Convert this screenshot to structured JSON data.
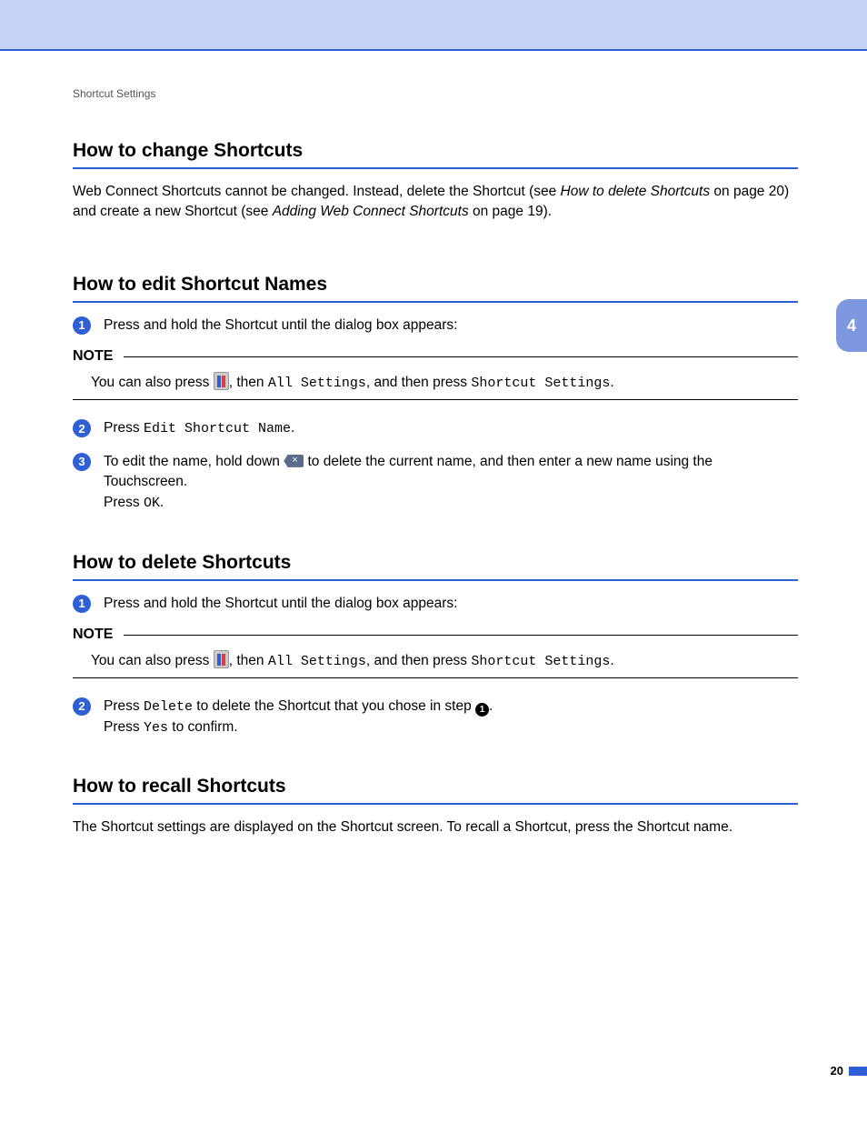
{
  "breadcrumb": "Shortcut Settings",
  "chapter_tab": "4",
  "page_number": "20",
  "sections": {
    "change": {
      "title": "How to change Shortcuts",
      "p1a": "Web Connect Shortcuts cannot be changed. Instead, delete the Shortcut (see ",
      "p1_link1": "How to delete Shortcuts",
      "p1b": " on page 20) and create a new Shortcut (see ",
      "p1_link2": "Adding Web Connect Shortcuts",
      "p1c": " on page 19)."
    },
    "edit": {
      "title": "How to edit Shortcut Names",
      "step1": "Press and hold the Shortcut until the dialog box appears:",
      "note_label": "NOTE",
      "note_a": "You can also press ",
      "note_b": ", then ",
      "note_mono1": "All Settings",
      "note_c": ", and then press ",
      "note_mono2": "Shortcut Settings",
      "note_d": ".",
      "step2_a": "Press ",
      "step2_mono": "Edit Shortcut Name",
      "step2_b": ".",
      "step3_a": "To edit the name, hold down ",
      "step3_b": " to delete the current name, and then enter a new name using the Touchscreen.",
      "step3_c": "Press ",
      "step3_mono": "OK",
      "step3_d": "."
    },
    "delete": {
      "title": "How to delete Shortcuts",
      "step1": "Press and hold the Shortcut until the dialog box appears:",
      "note_label": "NOTE",
      "note_a": "You can also press ",
      "note_b": ", then ",
      "note_mono1": "All Settings",
      "note_c": ", and then press ",
      "note_mono2": "Shortcut Settings",
      "note_d": ".",
      "step2_a": "Press ",
      "step2_mono1": "Delete",
      "step2_b": " to delete the Shortcut that you chose in step ",
      "step2_ref": "1",
      "step2_c": ".",
      "step2_d": "Press ",
      "step2_mono2": "Yes",
      "step2_e": " to confirm."
    },
    "recall": {
      "title": "How to recall Shortcuts",
      "p1": "The Shortcut settings are displayed on the Shortcut screen. To recall a Shortcut, press the Shortcut name."
    }
  }
}
